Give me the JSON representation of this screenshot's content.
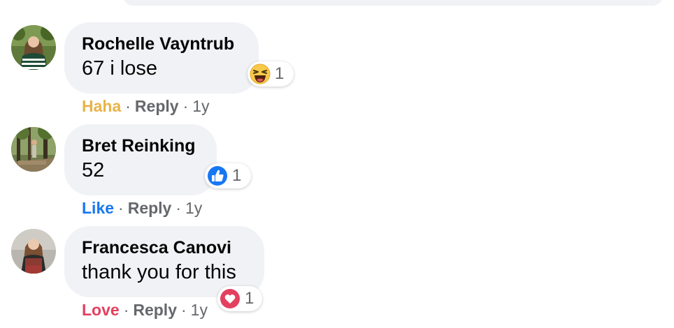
{
  "comments": [
    {
      "author": "Rochelle Vayntrub",
      "text": "67 i lose",
      "reaction": {
        "icon": "haha-emoji-icon",
        "count": "1"
      },
      "reacted_label": "Haha",
      "reacted_color": "#e8b34a",
      "reply_label": "Reply",
      "separator": "·",
      "time": "1y"
    },
    {
      "author": "Bret Reinking",
      "text": "52",
      "reaction": {
        "icon": "like-thumbs-up-icon",
        "count": "1"
      },
      "reacted_label": "Like",
      "reacted_color": "#1877f2",
      "reply_label": "Reply",
      "separator": "·",
      "time": "1y"
    },
    {
      "author": "Francesca Canovi",
      "text": "thank you for this",
      "reaction": {
        "icon": "love-heart-icon",
        "count": "1"
      },
      "reacted_label": "Love",
      "reacted_color": "#e4405f",
      "reply_label": "Reply",
      "separator": "·",
      "time": "1y"
    }
  ]
}
